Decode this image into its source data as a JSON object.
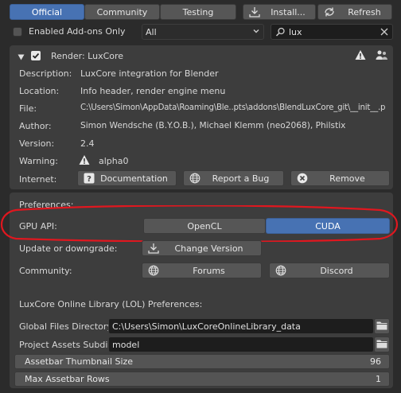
{
  "tabs": {
    "official": "Official",
    "community": "Community",
    "testing": "Testing",
    "install": "Install...",
    "refresh": "Refresh"
  },
  "filter": {
    "enabled_only_label": "Enabled Add-ons Only",
    "category_value": "All",
    "search_value": "lux"
  },
  "addon": {
    "title": "Render: LuxCore",
    "rows": [
      {
        "label": "Description:",
        "value": "LuxCore integration for Blender"
      },
      {
        "label": "Location:",
        "value": "Info header, render engine menu"
      },
      {
        "label": "File:",
        "value": "C:\\Users\\Simon\\AppData\\Roaming\\Ble..pts\\addons\\BlendLuxCore_git\\__init__.p"
      },
      {
        "label": "Author:",
        "value": "Simon Wendsche (B.Y.O.B.), Michael Klemm (neo2068), Philstix"
      },
      {
        "label": "Version:",
        "value": "2.4"
      },
      {
        "label": "Warning:",
        "value": "alpha0"
      }
    ],
    "internet_label": "Internet:",
    "documentation": "Documentation",
    "report_bug": "Report a Bug",
    "remove": "Remove"
  },
  "prefs": {
    "heading": "Preferences:",
    "gpu_api_label": "GPU API:",
    "opencl": "OpenCL",
    "cuda": "CUDA",
    "update_label": "Update or downgrade:",
    "change_version": "Change Version",
    "community_label": "Community:",
    "forums": "Forums",
    "discord": "Discord",
    "lol_heading": "LuxCore Online Library (LOL) Preferences:",
    "global_dir_label": "Global Files Directory:",
    "global_dir_value": "C:\\Users\\Simon\\LuxCoreOnlineLibrary_data",
    "project_label": "Project Assets Subdi...",
    "project_value": "model",
    "thumb_label": "Assetbar Thumbnail Size",
    "thumb_value": "96",
    "rows_label": "Max Assetbar Rows",
    "rows_value": "1"
  },
  "colors": {
    "accent": "#4772b3",
    "annotation": "#e0171f",
    "background": "#2b2b2b",
    "panel": "#3d3d3d"
  }
}
